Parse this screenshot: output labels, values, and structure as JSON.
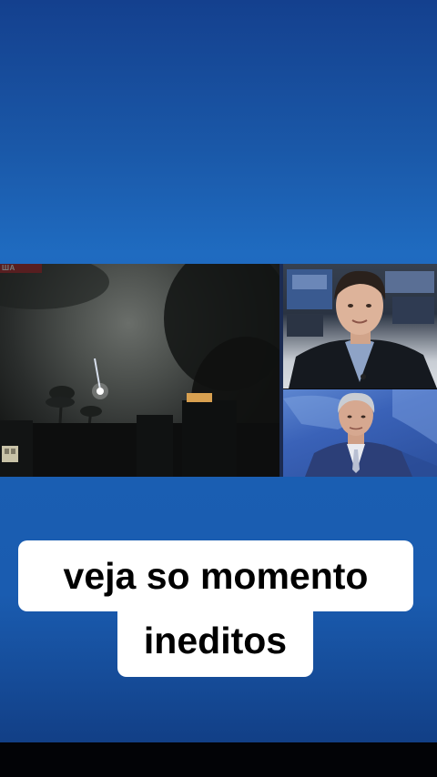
{
  "video": {
    "channel_logo": "ША",
    "left_scene": "night-sky-meteor",
    "right_top_scene": "news-studio-reporter",
    "right_bottom_scene": "news-anchor"
  },
  "caption": {
    "line1": "veja so momento",
    "line2": "ineditos"
  },
  "colors": {
    "background_top": "#14408e",
    "background_mid": "#1f6bc0",
    "caption_bg": "#ffffff",
    "caption_text": "#000000"
  }
}
